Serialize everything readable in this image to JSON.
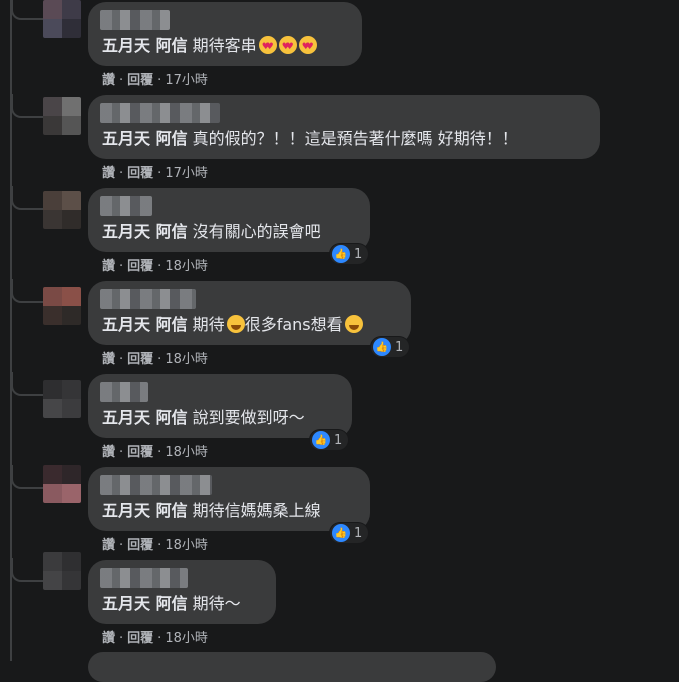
{
  "comments": [
    {
      "mention": "五月天 阿信",
      "text": "期待客串",
      "emoji": [
        "heart-eyes",
        "heart-eyes",
        "heart-eyes"
      ],
      "like": "讚",
      "reply": "回覆",
      "time": "17小時",
      "reaction_count": ""
    },
    {
      "mention": "五月天 阿信",
      "text": "真的假的？！！這是預告著什麼嗎 好期待！！",
      "emoji": [],
      "like": "讚",
      "reply": "回覆",
      "time": "17小時",
      "reaction_count": ""
    },
    {
      "mention": "五月天 阿信",
      "text": "沒有關心的誤會吧",
      "emoji": [],
      "like": "讚",
      "reply": "回覆",
      "time": "18小時",
      "reaction_count": "1"
    },
    {
      "mention": "五月天 阿信",
      "text_a": "期待",
      "text_b": "很多fans想看",
      "like": "讚",
      "reply": "回覆",
      "time": "18小時",
      "reaction_count": "1"
    },
    {
      "mention": "五月天 阿信",
      "text": "說到要做到呀～",
      "emoji": [],
      "like": "讚",
      "reply": "回覆",
      "time": "18小時",
      "reaction_count": "1"
    },
    {
      "mention": "五月天 阿信",
      "text": "期待信媽媽桑上線",
      "emoji": [],
      "like": "讚",
      "reply": "回覆",
      "time": "18小時",
      "reaction_count": "1"
    },
    {
      "mention": "五月天 阿信",
      "text": "期待～",
      "emoji": [],
      "like": "讚",
      "reply": "回覆",
      "time": "18小時",
      "reaction_count": ""
    }
  ],
  "colors": {
    "background": "#18191a",
    "bubble": "#3a3b3c",
    "like_blue": "#2d88ff"
  }
}
